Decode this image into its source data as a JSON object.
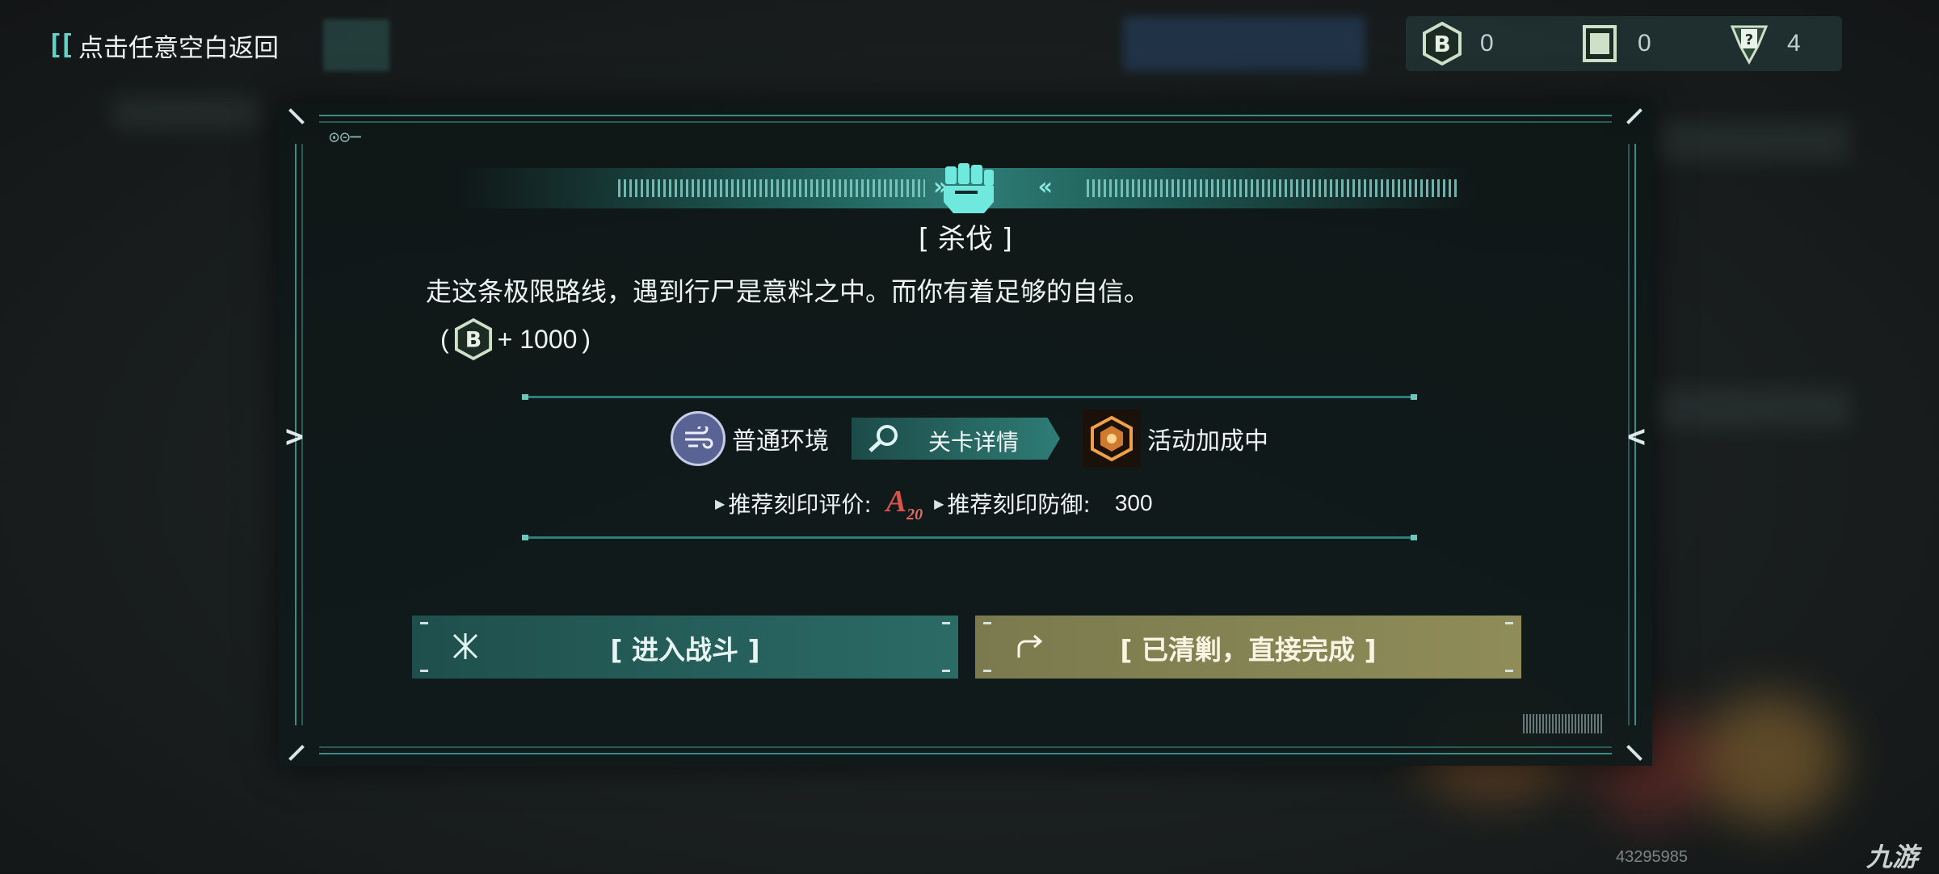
{
  "top_bar": {
    "back_bracket": "[[",
    "back_label": "点击任意空白返回",
    "currencies": [
      {
        "icon": "b-coin-icon",
        "value": "0"
      },
      {
        "icon": "ticket-icon",
        "value": "0"
      },
      {
        "icon": "question-card-icon",
        "value": "4"
      }
    ]
  },
  "dialog": {
    "deco_tag": "⊙⊝─",
    "header_icon": "fist-icon",
    "title": "[ 杀伐 ]",
    "description": "走这条极限路线，遇到行尸是意料之中。而你有着足够的自信。",
    "reward": {
      "open": "(",
      "icon": "b-coin-icon",
      "text": "+ 1000",
      "close": ")"
    },
    "environment_label": "普通环境",
    "detail_button_label": "关卡详情",
    "bonus_label": "活动加成中",
    "recommend_rating_label": "推荐刻印评价:",
    "recommend_rating_grade": "A",
    "recommend_rating_sub": "20",
    "recommend_defense_label": "推荐刻印防御:",
    "recommend_defense_value": "300",
    "nav_prev": ">",
    "nav_next": "<",
    "fight_button_label": "[ 进入战斗 ]",
    "skip_button_label": "[ 已清剿，直接完成 ]"
  },
  "footer": {
    "id_text": "43295985",
    "logo_text": "九游"
  },
  "colors": {
    "accent_teal": "#2f7c76",
    "skip_gold": "#8f8c58",
    "grade_red": "#d9534b"
  }
}
